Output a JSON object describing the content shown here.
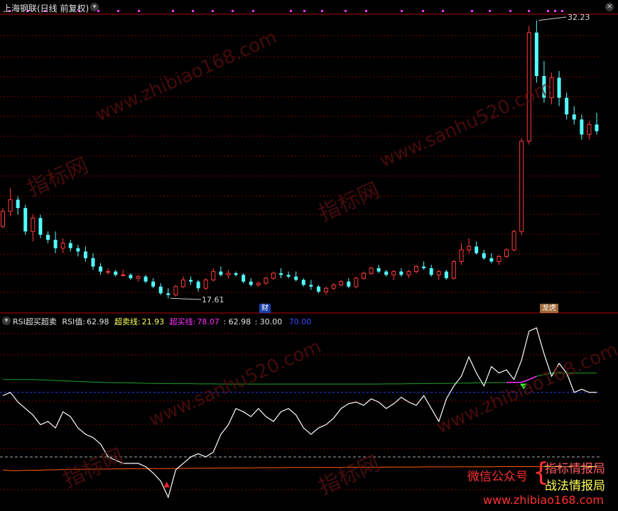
{
  "chart_title": "上海钢联(日线 前复权)",
  "price_panel": {
    "high_label": "32.23",
    "low_label": "17.61",
    "event_marker_1": "财",
    "event_marker_2": "龙虎",
    "candles": [
      [
        19.9,
        21.0,
        19.8,
        20.8
      ],
      [
        20.8,
        22.2,
        20.5,
        21.5
      ],
      [
        21.5,
        21.7,
        20.6,
        21.0
      ],
      [
        21.0,
        21.2,
        19.4,
        19.6
      ],
      [
        19.6,
        20.6,
        19.0,
        20.4
      ],
      [
        20.4,
        20.6,
        19.2,
        19.4
      ],
      [
        19.4,
        19.6,
        18.9,
        19.1
      ],
      [
        19.1,
        19.6,
        18.3,
        18.6
      ],
      [
        18.6,
        19.2,
        18.3,
        18.9
      ],
      [
        18.9,
        19.1,
        18.4,
        18.6
      ],
      [
        18.6,
        18.8,
        18.1,
        18.4
      ],
      [
        18.4,
        18.7,
        17.8,
        18.0
      ],
      [
        18.0,
        18.3,
        17.3,
        17.5
      ],
      [
        17.5,
        17.7,
        17.0,
        17.2
      ],
      [
        17.2,
        17.4,
        17.0,
        17.2
      ],
      [
        17.2,
        17.3,
        16.9,
        17.0
      ],
      [
        17.0,
        17.3,
        16.9,
        17.0
      ],
      [
        17.0,
        17.1,
        16.7,
        16.8
      ],
      [
        16.8,
        17.0,
        16.6,
        16.9
      ],
      [
        16.9,
        17.0,
        16.5,
        16.6
      ],
      [
        16.6,
        16.8,
        16.2,
        16.3
      ],
      [
        16.3,
        16.5,
        15.8,
        15.9
      ],
      [
        15.9,
        16.2,
        15.6,
        15.8
      ],
      [
        15.8,
        16.4,
        15.7,
        16.3
      ],
      [
        16.3,
        16.9,
        16.2,
        16.7
      ],
      [
        16.7,
        16.9,
        16.4,
        16.6
      ],
      [
        16.6,
        16.7,
        16.0,
        16.2
      ],
      [
        16.2,
        16.8,
        16.1,
        16.7
      ],
      [
        16.7,
        17.4,
        16.6,
        17.2
      ],
      [
        17.2,
        17.5,
        16.9,
        17.0
      ],
      [
        17.0,
        17.3,
        16.8,
        17.1
      ],
      [
        17.1,
        17.2,
        16.9,
        17.0
      ],
      [
        17.0,
        17.1,
        16.5,
        16.6
      ],
      [
        16.6,
        16.8,
        16.3,
        16.4
      ],
      [
        16.4,
        16.6,
        16.3,
        16.5
      ],
      [
        16.5,
        16.9,
        16.4,
        16.8
      ],
      [
        16.8,
        17.2,
        16.7,
        17.1
      ],
      [
        17.1,
        17.4,
        16.8,
        17.0
      ],
      [
        17.0,
        17.2,
        16.8,
        16.9
      ],
      [
        16.9,
        17.2,
        16.6,
        16.7
      ],
      [
        16.7,
        16.8,
        16.3,
        16.4
      ],
      [
        16.4,
        16.7,
        16.1,
        16.3
      ],
      [
        16.3,
        16.4,
        15.9,
        16.0
      ],
      [
        16.0,
        16.3,
        15.8,
        16.2
      ],
      [
        16.2,
        16.5,
        16.1,
        16.4
      ],
      [
        16.4,
        16.7,
        16.3,
        16.6
      ],
      [
        16.6,
        16.8,
        16.2,
        16.3
      ],
      [
        16.3,
        16.9,
        16.2,
        16.8
      ],
      [
        16.8,
        17.2,
        16.7,
        17.1
      ],
      [
        17.1,
        17.5,
        17.0,
        17.4
      ],
      [
        17.4,
        17.6,
        17.1,
        17.2
      ],
      [
        17.2,
        17.3,
        16.9,
        17.0
      ],
      [
        17.0,
        17.3,
        16.7,
        17.2
      ],
      [
        17.2,
        17.4,
        16.9,
        17.0
      ],
      [
        17.0,
        17.3,
        16.8,
        17.2
      ],
      [
        17.2,
        17.6,
        17.1,
        17.5
      ],
      [
        17.5,
        17.8,
        17.3,
        17.4
      ],
      [
        17.4,
        17.6,
        16.9,
        17.0
      ],
      [
        17.0,
        17.3,
        16.7,
        17.2
      ],
      [
        17.2,
        17.3,
        16.7,
        16.8
      ],
      [
        16.8,
        17.9,
        16.7,
        17.8
      ],
      [
        17.8,
        18.9,
        17.6,
        18.5
      ],
      [
        18.5,
        19.2,
        18.3,
        18.7
      ],
      [
        18.7,
        19.0,
        18.2,
        18.3
      ],
      [
        18.3,
        18.5,
        17.9,
        18.0
      ],
      [
        18.0,
        18.3,
        17.7,
        17.8
      ],
      [
        17.8,
        18.2,
        17.6,
        18.1
      ],
      [
        18.1,
        18.6,
        18.0,
        18.5
      ],
      [
        18.5,
        19.7,
        18.4,
        19.6
      ],
      [
        19.6,
        25.2,
        19.4,
        25.0
      ],
      [
        25.0,
        31.9,
        24.8,
        31.5
      ],
      [
        31.5,
        32.23,
        28.5,
        28.9
      ],
      [
        28.9,
        29.8,
        27.3,
        27.6
      ],
      [
        27.6,
        29.1,
        27.2,
        28.8
      ],
      [
        28.8,
        29.2,
        27.1,
        27.6
      ],
      [
        27.6,
        27.9,
        26.3,
        26.6
      ],
      [
        26.6,
        27.1,
        26.0,
        26.3
      ],
      [
        26.3,
        26.6,
        25.1,
        25.4
      ],
      [
        25.4,
        26.2,
        25.1,
        26.0
      ],
      [
        26.0,
        26.7,
        25.4,
        25.6
      ]
    ],
    "price_min": 17.61,
    "price_max": 32.23
  },
  "rsi_panel": {
    "label": "RSI超买超卖",
    "rsi_label": "RSI值:",
    "rsi_value": "62.98",
    "oversold_label": "超卖线:",
    "oversold_value": "21.93",
    "overbought_label": "超买线:",
    "overbought_value": "78.07",
    "extra_value": ": 62.98",
    "level_30": ": 30.00",
    "level_70": "70.00",
    "rsi_series": [
      68,
      70,
      64,
      60,
      56,
      50,
      52,
      48,
      58,
      55,
      48,
      44,
      42,
      38,
      30,
      28,
      26,
      26,
      26,
      24,
      20,
      15,
      5,
      22,
      26,
      30,
      32,
      30,
      33,
      44,
      50,
      60,
      58,
      55,
      60,
      55,
      52,
      58,
      60,
      56,
      48,
      44,
      48,
      50,
      54,
      60,
      63,
      64,
      62,
      66,
      64,
      60,
      63,
      67,
      64,
      62,
      68,
      60,
      52,
      66,
      74,
      80,
      92,
      82,
      74,
      86,
      82,
      84,
      78,
      90,
      108,
      110,
      94,
      80,
      88,
      82,
      70,
      72,
      70,
      70
    ],
    "oversold_series": [
      22,
      21.5,
      21.5,
      21.7,
      21.8,
      21.8,
      22,
      22,
      22.2,
      22.3,
      22.3,
      22.4,
      22.4,
      22.5,
      22.5,
      22.6,
      22.6,
      22.7,
      22.7,
      22.7,
      22.8,
      22.8,
      22.8,
      22.9,
      22.9,
      23,
      23,
      23,
      23.1,
      23.1,
      23.1,
      23.2,
      23.2,
      23.2,
      23.3,
      23.3,
      23.3,
      23.3,
      23.4,
      23.4,
      23.4,
      23.4,
      23.5,
      23.5,
      23.5,
      23.5,
      23.6,
      23.6,
      23.6,
      23.6,
      23.6,
      23.7,
      23.7,
      23.7,
      23.7,
      23.7,
      23.8,
      23.8,
      23.8,
      23.8,
      23.8,
      23.9,
      23.9,
      23.9,
      23.9,
      23.9,
      24,
      24,
      24,
      24,
      24,
      24,
      24,
      24,
      24,
      24,
      24,
      24,
      24,
      24
    ],
    "overbought_series": [
      78,
      78,
      78,
      78,
      78,
      77.8,
      77.6,
      77.4,
      77.2,
      77,
      76.8,
      76.6,
      76.4,
      76.2,
      76.1,
      76,
      76,
      75.9,
      75.8,
      75.7,
      75.6,
      75.5,
      75.5,
      75.4,
      75.4,
      75.4,
      75.3,
      75.3,
      75.3,
      75.2,
      75.2,
      75.2,
      75.2,
      75.2,
      75.2,
      75.2,
      75.2,
      75.2,
      75.2,
      75.2,
      75.2,
      75.2,
      75.2,
      75.2,
      75.2,
      75.2,
      75.2,
      75.2,
      75.2,
      75.2,
      75.2,
      75.3,
      75.3,
      75.3,
      75.4,
      75.4,
      75.5,
      75.5,
      75.6,
      75.6,
      75.7,
      75.8,
      75.8,
      75.9,
      76,
      76,
      76.1,
      76.1,
      76.2,
      76.3,
      78,
      80,
      81,
      82,
      82,
      82,
      82,
      82,
      82,
      82
    ],
    "rsi_min": 0,
    "rsi_max": 110
  },
  "watermarks": [
    "www.zhibiao168.com",
    "www.sanhu520.com",
    "指标网"
  ],
  "footer": {
    "wechat_label": "微信公众号",
    "line1": "指标情报局",
    "line2": "战法情报局",
    "url": "www.zhibiao168.com"
  },
  "colors": {
    "up": "#ff3b3b",
    "down": "#54ffff",
    "grid": "#7a0000",
    "axis": "#b00000",
    "rsi": "#ffffff",
    "oversold": "#ff5a00",
    "overbought": "#1aa02a",
    "level30": "#aaaaaa",
    "level70": "#2a3bff",
    "magenta": "#ff33ff",
    "yellow": "#ffff55"
  }
}
